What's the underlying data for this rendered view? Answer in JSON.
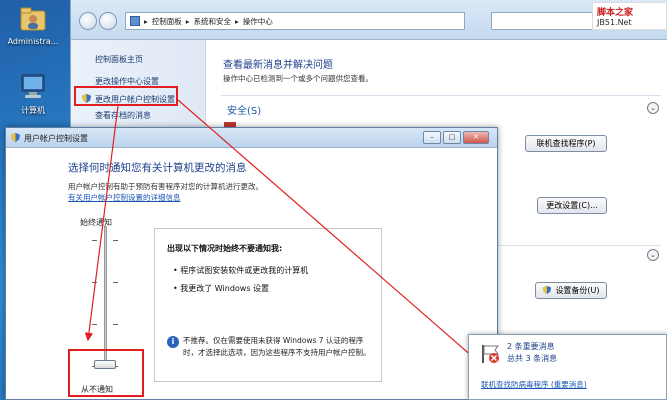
{
  "desktop": {
    "icons": [
      {
        "label": "Administra...",
        "icon": "user-folder-icon"
      },
      {
        "label": "计算机",
        "icon": "computer-icon"
      }
    ]
  },
  "control_panel": {
    "breadcrumb": [
      "控制面板",
      "系统和安全",
      "操作中心"
    ],
    "sidebar": {
      "items": [
        {
          "label": "控制面板主页"
        },
        {
          "label": "更改操作中心设置"
        },
        {
          "label": "更改用户帐户控制设置"
        },
        {
          "label": "查看存档的消息"
        }
      ]
    },
    "main": {
      "title": "查看最新消息并解决问题",
      "subtitle": "操作中心已检测到一个或多个问题供您查看。",
      "section_security": "安全(S)",
      "btn_find_program": "联机查找程序(P)",
      "btn_change_settings": "更改设置(C)...",
      "btn_backup": "设置备份(U)"
    }
  },
  "uac_dialog": {
    "title": "用户帐户控制设置",
    "heading": "选择何时通知您有关计算机更改的消息",
    "description": "用户帐户控制有助于预防有害程序对您的计算机进行更改。",
    "link": "有关用户帐户控制设置的详细信息",
    "slider": {
      "top_label": "始终通知",
      "bottom_label": "从不通知",
      "level": 0
    },
    "info": {
      "heading": "出现以下情况时始终不要通知我:",
      "bullets": [
        "程序试图安装软件或更改我的计算机",
        "我更改了 Windows 设置"
      ],
      "note": "不推荐。仅在需要使用未获得 Windows 7 认证的程序时，才选择此选项，因为这些程序不支持用户帐户控制。"
    }
  },
  "notification": {
    "line1": "2 条重要消息",
    "line2": "总共 3 条消息",
    "link": "联机查找防病毒程序 (重要消息)"
  },
  "watermark": {
    "line1": "脚本之家",
    "line2": "JB51.Net"
  },
  "colors": {
    "accent_blue": "#1e3f8c",
    "annotation_red": "#e02020",
    "link_blue": "#1a56b4"
  }
}
